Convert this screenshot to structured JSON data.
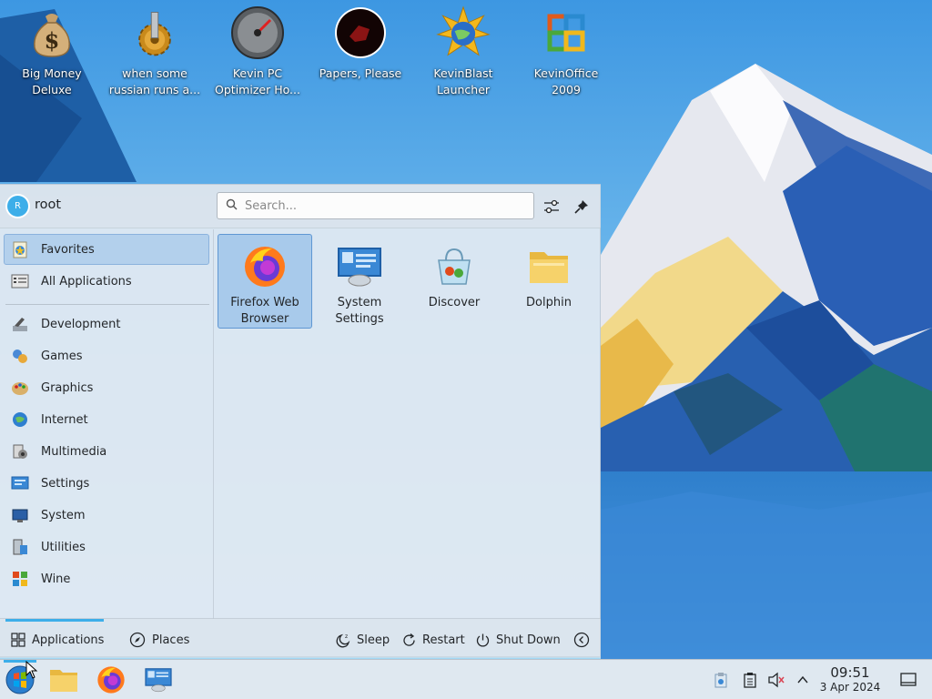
{
  "desktop": {
    "icons": [
      {
        "label": "Big Money Deluxe",
        "line1": "Big Money",
        "line2": "Deluxe",
        "icon": "money-bag-icon"
      },
      {
        "label": "when some russian runs a...",
        "line1": "when some",
        "line2": "russian runs a...",
        "icon": "gear-icon"
      },
      {
        "label": "Kevin PC Optimizer Ho...",
        "line1": "Kevin PC",
        "line2": "Optimizer Ho...",
        "icon": "speedometer-icon"
      },
      {
        "label": "Papers, Please",
        "line1": "Papers, Please",
        "line2": "",
        "icon": "papers-please-icon"
      },
      {
        "label": "KevinBlast Launcher",
        "line1": "KevinBlast",
        "line2": "Launcher",
        "icon": "globe-star-icon"
      },
      {
        "label": "KevinOffice 2009",
        "line1": "KevinOffice",
        "line2": "2009",
        "icon": "office-logo-icon"
      }
    ]
  },
  "launcher": {
    "user_initial": "R",
    "user_name": "root",
    "search_placeholder": "Search...",
    "categories": [
      {
        "label": "Favorites",
        "icon": "favorites-icon",
        "selected": true
      },
      {
        "label": "All Applications",
        "icon": "all-applications-icon"
      },
      {
        "label": "Development",
        "icon": "development-icon"
      },
      {
        "label": "Games",
        "icon": "games-icon"
      },
      {
        "label": "Graphics",
        "icon": "graphics-icon"
      },
      {
        "label": "Internet",
        "icon": "internet-icon"
      },
      {
        "label": "Multimedia",
        "icon": "multimedia-icon"
      },
      {
        "label": "Settings",
        "icon": "settings-icon"
      },
      {
        "label": "System",
        "icon": "system-icon"
      },
      {
        "label": "Utilities",
        "icon": "utilities-icon"
      },
      {
        "label": "Wine",
        "icon": "wine-icon"
      }
    ],
    "favorites": [
      {
        "line1": "Firefox Web",
        "line2": "Browser",
        "icon": "firefox-icon",
        "selected": true
      },
      {
        "line1": "System",
        "line2": "Settings",
        "icon": "system-settings-icon"
      },
      {
        "line1": "Discover",
        "line2": "",
        "icon": "discover-icon"
      },
      {
        "line1": "Dolphin",
        "line2": "",
        "icon": "dolphin-folder-icon"
      }
    ],
    "footer": {
      "tab_applications": "Applications",
      "tab_places": "Places",
      "sleep": "Sleep",
      "restart": "Restart",
      "shutdown": "Shut Down"
    }
  },
  "taskbar": {
    "pinned": [
      "start-menu-icon",
      "file-manager-icon",
      "firefox-icon",
      "system-settings-icon"
    ],
    "tray": [
      "clipboard-icon",
      "notes-icon",
      "volume-muted-icon",
      "chevron-up-icon"
    ],
    "time": "09:51",
    "date": "3 Apr 2024"
  },
  "colors": {
    "accent": "#3daee9",
    "selection": "#93bee8"
  }
}
